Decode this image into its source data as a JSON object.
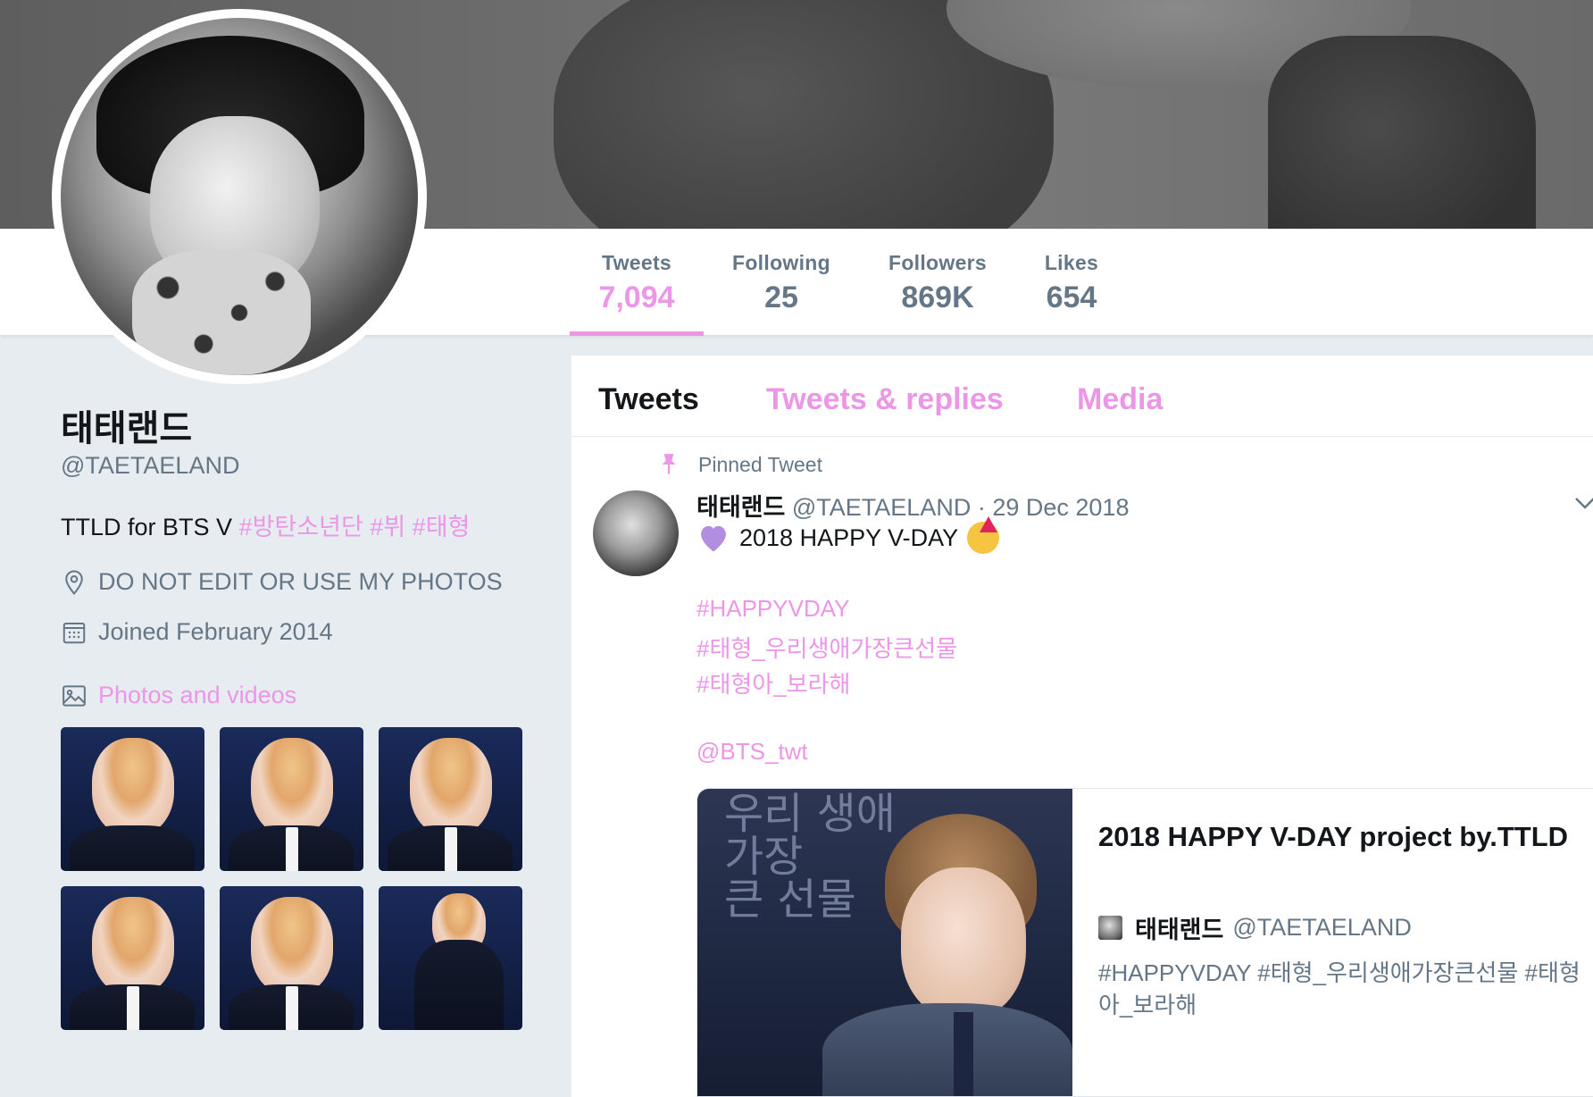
{
  "colors": {
    "accent": "#ec96e8",
    "text": "#14171a",
    "muted": "#657786",
    "background": "#e6ecf0"
  },
  "nav": {
    "stats": {
      "tweets": {
        "label": "Tweets",
        "value": "7,094"
      },
      "following": {
        "label": "Following",
        "value": "25"
      },
      "followers": {
        "label": "Followers",
        "value": "869K"
      },
      "likes": {
        "label": "Likes",
        "value": "654"
      }
    }
  },
  "profile": {
    "name": "태태랜드",
    "handle": "@TAETAELAND",
    "bio_text": "TTLD for BTS V",
    "bio_tags": [
      "#방탄소년단",
      "#뷔",
      "#태형"
    ],
    "location": "DO NOT EDIT OR USE MY PHOTOS",
    "joined": "Joined February 2014",
    "photos_label": "Photos and videos",
    "icons": {
      "location": "location-pin-icon",
      "joined": "calendar-icon",
      "photos": "image-icon"
    }
  },
  "timeline": {
    "tabs": [
      "Tweets",
      "Tweets & replies",
      "Media"
    ],
    "pinned_label": "Pinned Tweet",
    "tweet": {
      "author_name": "태태랜드",
      "author_handle": "@TAETAELAND",
      "date": "· 29 Dec 2018",
      "text": "2018 HAPPY V-DAY",
      "hashtags": [
        "#HAPPYVDAY",
        "#태형_우리생애가장큰선물",
        "#태형아_보라해"
      ],
      "mention": "@BTS_twt"
    },
    "card": {
      "image_text": [
        "우리 생애",
        "가장",
        "큰 선물"
      ],
      "title": "2018 HAPPY V-DAY project by.TTLD",
      "author_name": "태태랜드",
      "author_handle": "@TAETAELAND",
      "description": "#HAPPYVDAY #태형_우리생애가장큰선물 #태형아_보라해"
    }
  }
}
